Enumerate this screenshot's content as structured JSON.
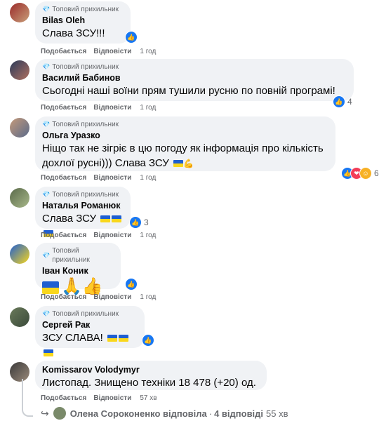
{
  "badge_label": "Топовий прихильник",
  "actions": {
    "like": "Подобається",
    "reply": "Відповісти"
  },
  "comments": [
    {
      "author": "Bilas Oleh",
      "text": "Слава ЗСУ!!!",
      "time": "1 год",
      "reactions": ""
    },
    {
      "author": "Василий Бабинов",
      "text": "Сьогодні наші воїни прям тушили русню по повній програмі!",
      "time": "1 год",
      "reactions": "4"
    },
    {
      "author": "Ольга Уразко",
      "text": "Ніщо так не зігріє в цю погоду як інформація про кількість",
      "text2": "дохлої русні))) Слава ЗСУ",
      "time": "1 год",
      "reactions": "6"
    },
    {
      "author": "Наталья Романюк",
      "text": "Слава ЗСУ",
      "time": "1 год",
      "reactions": "3"
    },
    {
      "author": "Іван Коник",
      "text": "🙏👍",
      "time": "1 год",
      "reactions": ""
    },
    {
      "author": "Сергей Рак",
      "text": "ЗСУ СЛАВА!",
      "time": "1 год",
      "reactions": ""
    },
    {
      "author": "Komissarov Volodymyr",
      "text": "Листопад. Знищено техніки 18 478 (+20) од.",
      "time": "57 хв",
      "reactions": ""
    }
  ],
  "replies_line": {
    "name": "Олена Сороконенко відповіла",
    "sep": "·",
    "count": "4 відповіді",
    "time": "55 хв"
  },
  "icons": {
    "badge": "diamond-icon",
    "like": "thumbs-up-icon",
    "heart": "heart-icon",
    "care": "care-icon",
    "reply": "reply-arrow-icon"
  },
  "colors": {
    "bubble": "#f0f2f5",
    "like": "#1877f2",
    "muted": "#65676b",
    "flag_blue": "#1f5fd1",
    "flag_yellow": "#f9d71c"
  }
}
